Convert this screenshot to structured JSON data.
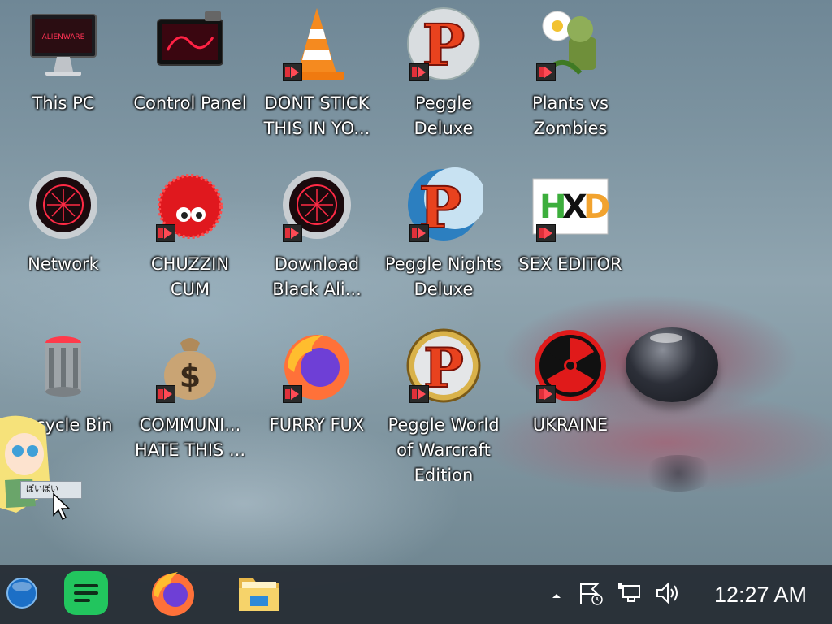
{
  "desktop": {
    "icons": [
      {
        "label": "This PC",
        "icon": "monitor-icon",
        "shortcut": false
      },
      {
        "label": "Control Panel",
        "icon": "control-panel-icon",
        "shortcut": false
      },
      {
        "label": "DONT STICK\nTHIS IN YO...",
        "icon": "vlc-cone-icon",
        "shortcut": true
      },
      {
        "label": "Peggle\nDeluxe",
        "icon": "peggle-icon",
        "shortcut": true
      },
      {
        "label": "Plants vs\nZombies",
        "icon": "plants-vs-zombies-icon",
        "shortcut": true
      },
      {
        "label": "Network",
        "icon": "network-orb-icon",
        "shortcut": false
      },
      {
        "label": "CHUZZIN\nCUM",
        "icon": "chuzzle-icon",
        "shortcut": true
      },
      {
        "label": "Download\nBlack Ali...",
        "icon": "alienware-orb-icon",
        "shortcut": true
      },
      {
        "label": "Peggle Nights\nDeluxe",
        "icon": "peggle-nights-icon",
        "shortcut": true
      },
      {
        "label": "SEX EDITOR",
        "icon": "hxd-icon",
        "shortcut": true
      },
      {
        "label": "Recycle Bin",
        "icon": "recycle-bin-icon",
        "shortcut": false
      },
      {
        "label": "COMMUNI...\nHATE THIS ...",
        "icon": "money-bag-icon",
        "shortcut": true
      },
      {
        "label": "FURRY FUX",
        "icon": "firefox-icon",
        "shortcut": true
      },
      {
        "label": "Peggle World\nof Warcraft\nEdition",
        "icon": "peggle-wow-icon",
        "shortcut": true
      },
      {
        "label": "UKRAINE",
        "icon": "radiation-icon",
        "shortcut": true
      }
    ]
  },
  "overlay": {
    "tooltip_text": "ぽいぽい",
    "character": "cartoon-girl-sticker"
  },
  "taskbar": {
    "start": {
      "icon": "start-orb-icon"
    },
    "pinned": [
      {
        "name": "speechify-app-icon"
      },
      {
        "name": "firefox-taskbar-icon"
      },
      {
        "name": "file-explorer-icon"
      }
    ],
    "tray": {
      "chevron": "show-hidden-icons",
      "action_center": "flag-clock-icon",
      "network": "network-icon",
      "volume": "speaker-icon"
    },
    "clock": "12:27 AM"
  }
}
